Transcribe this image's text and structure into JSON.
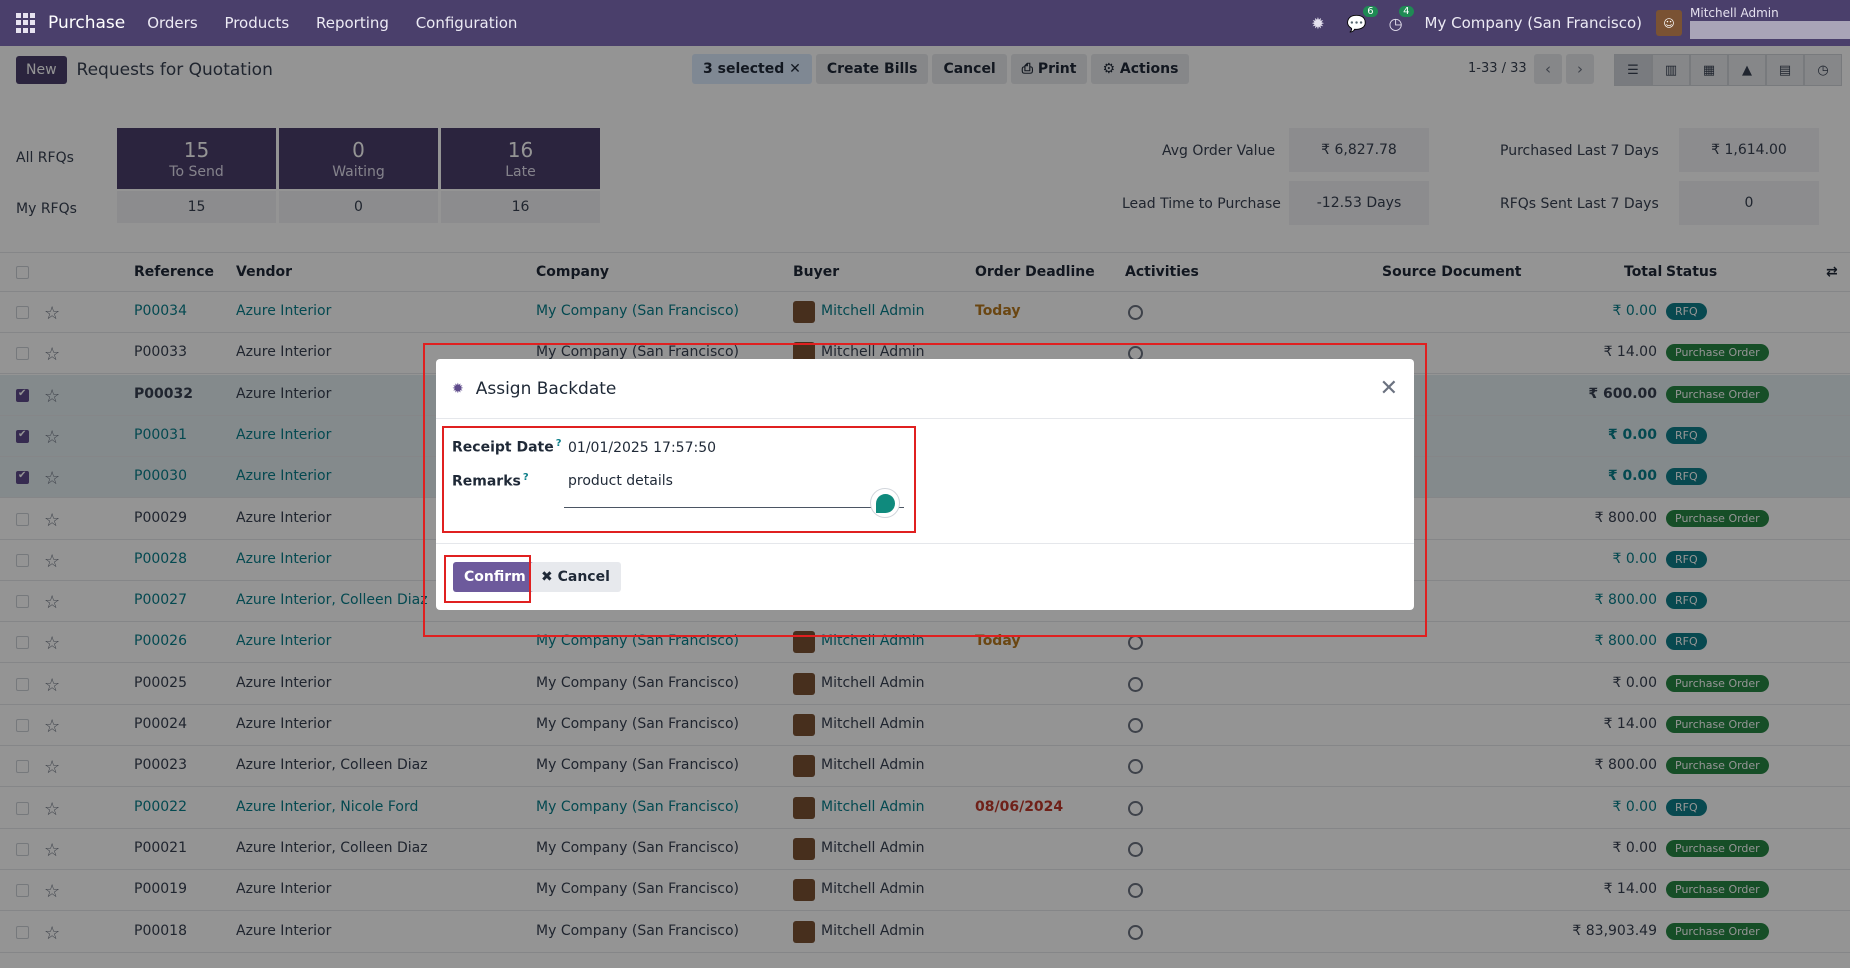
{
  "topbar": {
    "app": "Purchase",
    "menu": [
      "Orders",
      "Products",
      "Reporting",
      "Configuration"
    ],
    "chat_count": "6",
    "activity_count": "4",
    "company": "My Company (San Francisco)",
    "user": "Mitchell Admin"
  },
  "control": {
    "new_label": "New",
    "title": "Requests for Quotation",
    "selected": "3 selected",
    "create_bills": "Create Bills",
    "cancel": "Cancel",
    "print": "Print",
    "actions": "Actions",
    "pager": "1-33 / 33"
  },
  "dashboard": {
    "all_rfqs": "All RFQs",
    "my_rfqs": "My RFQs",
    "tiles": [
      {
        "n": "15",
        "t": "To Send",
        "my": "15"
      },
      {
        "n": "0",
        "t": "Waiting",
        "my": "0"
      },
      {
        "n": "16",
        "t": "Late",
        "my": "16"
      }
    ],
    "metrics": [
      {
        "label": "Avg Order Value",
        "value": "₹ 6,827.78"
      },
      {
        "label": "Purchased Last 7 Days",
        "value": "₹ 1,614.00"
      },
      {
        "label": "Lead Time to Purchase",
        "value": "-12.53 Days"
      },
      {
        "label": "RFQs Sent Last 7 Days",
        "value": "0"
      }
    ]
  },
  "columns": [
    "Reference",
    "Vendor",
    "Company",
    "Buyer",
    "Order Deadline",
    "Activities",
    "Source Document",
    "Total",
    "Status"
  ],
  "rows": [
    {
      "ref": "P00034",
      "vendor": "Azure Interior",
      "company": "My Company (San Francisco)",
      "buyer": "Mitchell Admin",
      "deadline": "Today",
      "total": "₹ 0.00",
      "status": "RFQ",
      "link": true,
      "sel": false
    },
    {
      "ref": "P00033",
      "vendor": "Azure Interior",
      "company": "My Company (San Francisco)",
      "buyer": "Mitchell Admin",
      "deadline": "",
      "total": "₹ 14.00",
      "status": "Purchase Order",
      "link": false,
      "sel": false
    },
    {
      "ref": "P00032",
      "vendor": "Azure Interior",
      "company": "",
      "buyer": "",
      "deadline": "",
      "total": "₹ 600.00",
      "status": "Purchase Order",
      "link": false,
      "sel": true
    },
    {
      "ref": "P00031",
      "vendor": "Azure Interior",
      "company": "",
      "buyer": "",
      "deadline": "",
      "total": "₹ 0.00",
      "status": "RFQ",
      "link": true,
      "sel": true
    },
    {
      "ref": "P00030",
      "vendor": "Azure Interior",
      "company": "",
      "buyer": "",
      "deadline": "",
      "total": "₹ 0.00",
      "status": "RFQ",
      "link": true,
      "sel": true
    },
    {
      "ref": "P00029",
      "vendor": "Azure Interior",
      "company": "",
      "buyer": "",
      "deadline": "",
      "total": "₹ 800.00",
      "status": "Purchase Order",
      "link": false,
      "sel": false
    },
    {
      "ref": "P00028",
      "vendor": "Azure Interior",
      "company": "",
      "buyer": "",
      "deadline": "",
      "total": "₹ 0.00",
      "status": "RFQ",
      "link": true,
      "sel": false
    },
    {
      "ref": "P00027",
      "vendor": "Azure Interior, Colleen Diaz",
      "company": "",
      "buyer": "",
      "deadline": "",
      "total": "₹ 800.00",
      "status": "RFQ",
      "link": true,
      "sel": false
    },
    {
      "ref": "P00026",
      "vendor": "Azure Interior",
      "company": "My Company (San Francisco)",
      "buyer": "Mitchell Admin",
      "deadline": "Today",
      "total": "₹ 800.00",
      "status": "RFQ",
      "link": true,
      "sel": false
    },
    {
      "ref": "P00025",
      "vendor": "Azure Interior",
      "company": "My Company (San Francisco)",
      "buyer": "Mitchell Admin",
      "deadline": "",
      "total": "₹ 0.00",
      "status": "Purchase Order",
      "link": false,
      "sel": false
    },
    {
      "ref": "P00024",
      "vendor": "Azure Interior",
      "company": "My Company (San Francisco)",
      "buyer": "Mitchell Admin",
      "deadline": "",
      "total": "₹ 14.00",
      "status": "Purchase Order",
      "link": false,
      "sel": false
    },
    {
      "ref": "P00023",
      "vendor": "Azure Interior, Colleen Diaz",
      "company": "My Company (San Francisco)",
      "buyer": "Mitchell Admin",
      "deadline": "",
      "total": "₹ 800.00",
      "status": "Purchase Order",
      "link": false,
      "sel": false
    },
    {
      "ref": "P00022",
      "vendor": "Azure Interior, Nicole Ford",
      "company": "My Company (San Francisco)",
      "buyer": "Mitchell Admin",
      "deadline": "08/06/2024",
      "total": "₹ 0.00",
      "status": "RFQ",
      "link": true,
      "sel": false
    },
    {
      "ref": "P00021",
      "vendor": "Azure Interior, Colleen Diaz",
      "company": "My Company (San Francisco)",
      "buyer": "Mitchell Admin",
      "deadline": "",
      "total": "₹ 0.00",
      "status": "Purchase Order",
      "link": false,
      "sel": false
    },
    {
      "ref": "P00019",
      "vendor": "Azure Interior",
      "company": "My Company (San Francisco)",
      "buyer": "Mitchell Admin",
      "deadline": "",
      "total": "₹ 14.00",
      "status": "Purchase Order",
      "link": false,
      "sel": false
    },
    {
      "ref": "P00018",
      "vendor": "Azure Interior",
      "company": "My Company (San Francisco)",
      "buyer": "Mitchell Admin",
      "deadline": "",
      "total": "₹ 83,903.49",
      "status": "Purchase Order",
      "link": false,
      "sel": false
    }
  ],
  "modal": {
    "title": "Assign Backdate",
    "receipt_label": "Receipt Date",
    "receipt_value": "01/01/2025 17:57:50",
    "remarks_label": "Remarks",
    "remarks_value": "product details",
    "help": "?",
    "confirm": "Confirm",
    "cancel": "Cancel"
  }
}
